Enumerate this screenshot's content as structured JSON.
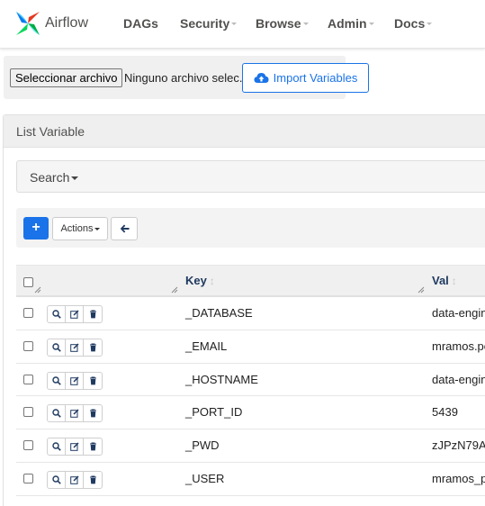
{
  "brand": {
    "name": "Airflow"
  },
  "nav": {
    "items": [
      {
        "label": "DAGs",
        "dropdown": false
      },
      {
        "label": "Security",
        "dropdown": true
      },
      {
        "label": "Browse",
        "dropdown": true
      },
      {
        "label": "Admin",
        "dropdown": true
      },
      {
        "label": "Docs",
        "dropdown": true
      }
    ]
  },
  "import_form": {
    "file_button_label": "Seleccionar archivo",
    "file_status": "Ninguno archivo selec.",
    "import_button_label": "Import Variables"
  },
  "panel": {
    "title": "List Variable"
  },
  "search": {
    "label": "Search"
  },
  "toolbar": {
    "add_label": "+",
    "actions_label": "Actions"
  },
  "table": {
    "columns": [
      {
        "label": "Key"
      },
      {
        "label": "Val"
      }
    ],
    "rows": [
      {
        "key": "_DATABASE",
        "val": "data-engin"
      },
      {
        "key": "_EMAIL",
        "val": "mramos.pe"
      },
      {
        "key": "_HOSTNAME",
        "val": "data-engin"
      },
      {
        "key": "_PORT_ID",
        "val": "5439"
      },
      {
        "key": "_PWD",
        "val": "zJPzN79A"
      },
      {
        "key": "_USER",
        "val": "mramos_p"
      }
    ]
  },
  "icons": {
    "row_actions": [
      "search-icon",
      "edit-icon",
      "trash-icon"
    ],
    "import": "cloud-upload-icon",
    "back": "arrow-left-icon"
  },
  "colors": {
    "accent": "#1a73e8",
    "header_text": "#1f3a60"
  }
}
